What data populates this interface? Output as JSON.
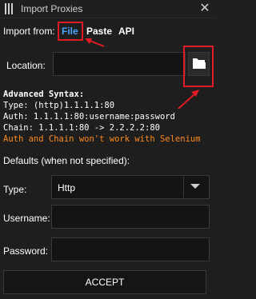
{
  "window": {
    "title": "Import Proxies",
    "close_glyph": "✕"
  },
  "import_from": {
    "label": "Import from:",
    "tabs": [
      {
        "label": "File",
        "active": true
      },
      {
        "label": "Paste",
        "active": false
      },
      {
        "label": "API",
        "active": false
      }
    ]
  },
  "location": {
    "label": "Location:",
    "value": "",
    "button_icon": "folder-icon"
  },
  "syntax": {
    "heading": "Advanced Syntax:",
    "lines": [
      "Type: (http)1.1.1.1:80",
      "Auth: 1.1.1.1:80:username:password",
      "Chain: 1.1.1.1:80 -> 2.2.2.2:80"
    ],
    "warning": "Auth and Chain won't work with Selenium"
  },
  "defaults": {
    "label": "Defaults (when not specified):",
    "type_label": "Type:",
    "type_value": "Http",
    "username_label": "Username:",
    "username_value": "",
    "password_label": "Password:",
    "password_value": ""
  },
  "accept_label": "ACCEPT",
  "colors": {
    "accent": "#4aa3ff",
    "warning": "#ff8a1f",
    "annotation": "#e01b24",
    "background": "#1e1e1e"
  }
}
